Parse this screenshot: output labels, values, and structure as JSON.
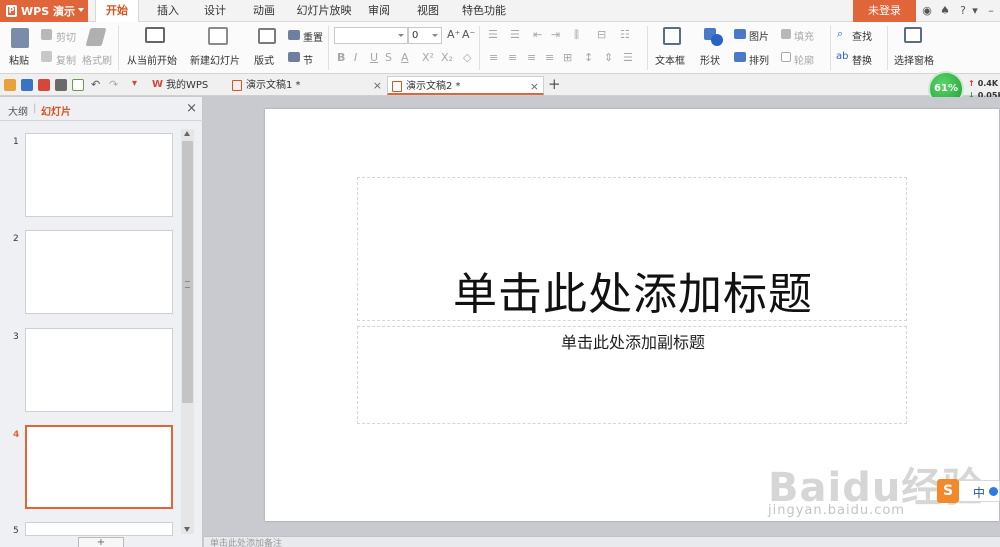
{
  "app": {
    "name": "WPS 演示",
    "login": "未登录"
  },
  "menu_tabs": [
    "开始",
    "插入",
    "设计",
    "动画",
    "幻灯片放映",
    "审阅",
    "视图",
    "特色功能"
  ],
  "ribbon": {
    "paste": "粘贴",
    "cut": "剪切",
    "copy": "复制",
    "format_painter": "格式刷",
    "from_current": "从当前开始",
    "new_slide": "新建幻灯片",
    "layout": "版式",
    "reset": "重置",
    "section": "节",
    "font_size": "0",
    "text_box": "文本框",
    "shape": "形状",
    "picture": "图片",
    "fill": "填充",
    "arrange": "排列",
    "outline": "轮廓",
    "find": "查找",
    "replace": "替换",
    "select_pane": "选择窗格"
  },
  "doc_tabs": [
    {
      "label": "我的WPS"
    },
    {
      "label": "演示文稿1 *"
    },
    {
      "label": "演示文稿2 *"
    }
  ],
  "speed": {
    "percent": "61%",
    "up": "0.4K",
    "down": "0.05K"
  },
  "left_panel": {
    "tab_outline": "大纲",
    "tab_slides": "幻灯片",
    "slide_numbers": [
      "1",
      "2",
      "3",
      "4",
      "5"
    ],
    "selected": "4"
  },
  "slide": {
    "title_placeholder": "单击此处添加标题",
    "subtitle_placeholder": "单击此处添加副标题"
  },
  "notes_placeholder": "单击此处添加备注",
  "watermark": {
    "main": "Baidu经验",
    "sub": "jingyan.baidu.com"
  },
  "ime": {
    "logo": "S",
    "lang": "中"
  },
  "colors": {
    "accent": "#e0653a",
    "selected_border": "#e0653a",
    "speed_green": "#1f9a34"
  }
}
